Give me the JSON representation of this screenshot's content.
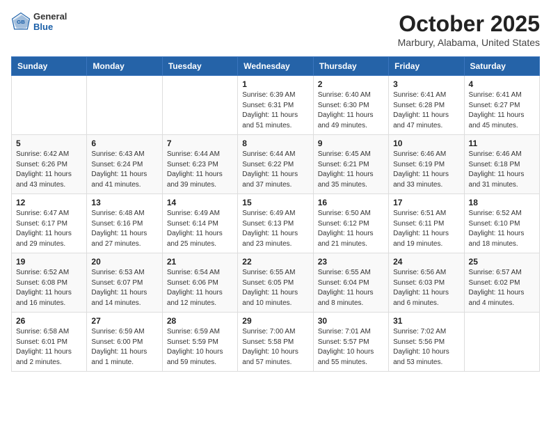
{
  "header": {
    "logo_general": "General",
    "logo_blue": "Blue",
    "month_title": "October 2025",
    "location": "Marbury, Alabama, United States"
  },
  "days_of_week": [
    "Sunday",
    "Monday",
    "Tuesday",
    "Wednesday",
    "Thursday",
    "Friday",
    "Saturday"
  ],
  "weeks": [
    [
      {
        "day": "",
        "info": ""
      },
      {
        "day": "",
        "info": ""
      },
      {
        "day": "",
        "info": ""
      },
      {
        "day": "1",
        "info": "Sunrise: 6:39 AM\nSunset: 6:31 PM\nDaylight: 11 hours\nand 51 minutes."
      },
      {
        "day": "2",
        "info": "Sunrise: 6:40 AM\nSunset: 6:30 PM\nDaylight: 11 hours\nand 49 minutes."
      },
      {
        "day": "3",
        "info": "Sunrise: 6:41 AM\nSunset: 6:28 PM\nDaylight: 11 hours\nand 47 minutes."
      },
      {
        "day": "4",
        "info": "Sunrise: 6:41 AM\nSunset: 6:27 PM\nDaylight: 11 hours\nand 45 minutes."
      }
    ],
    [
      {
        "day": "5",
        "info": "Sunrise: 6:42 AM\nSunset: 6:26 PM\nDaylight: 11 hours\nand 43 minutes."
      },
      {
        "day": "6",
        "info": "Sunrise: 6:43 AM\nSunset: 6:24 PM\nDaylight: 11 hours\nand 41 minutes."
      },
      {
        "day": "7",
        "info": "Sunrise: 6:44 AM\nSunset: 6:23 PM\nDaylight: 11 hours\nand 39 minutes."
      },
      {
        "day": "8",
        "info": "Sunrise: 6:44 AM\nSunset: 6:22 PM\nDaylight: 11 hours\nand 37 minutes."
      },
      {
        "day": "9",
        "info": "Sunrise: 6:45 AM\nSunset: 6:21 PM\nDaylight: 11 hours\nand 35 minutes."
      },
      {
        "day": "10",
        "info": "Sunrise: 6:46 AM\nSunset: 6:19 PM\nDaylight: 11 hours\nand 33 minutes."
      },
      {
        "day": "11",
        "info": "Sunrise: 6:46 AM\nSunset: 6:18 PM\nDaylight: 11 hours\nand 31 minutes."
      }
    ],
    [
      {
        "day": "12",
        "info": "Sunrise: 6:47 AM\nSunset: 6:17 PM\nDaylight: 11 hours\nand 29 minutes."
      },
      {
        "day": "13",
        "info": "Sunrise: 6:48 AM\nSunset: 6:16 PM\nDaylight: 11 hours\nand 27 minutes."
      },
      {
        "day": "14",
        "info": "Sunrise: 6:49 AM\nSunset: 6:14 PM\nDaylight: 11 hours\nand 25 minutes."
      },
      {
        "day": "15",
        "info": "Sunrise: 6:49 AM\nSunset: 6:13 PM\nDaylight: 11 hours\nand 23 minutes."
      },
      {
        "day": "16",
        "info": "Sunrise: 6:50 AM\nSunset: 6:12 PM\nDaylight: 11 hours\nand 21 minutes."
      },
      {
        "day": "17",
        "info": "Sunrise: 6:51 AM\nSunset: 6:11 PM\nDaylight: 11 hours\nand 19 minutes."
      },
      {
        "day": "18",
        "info": "Sunrise: 6:52 AM\nSunset: 6:10 PM\nDaylight: 11 hours\nand 18 minutes."
      }
    ],
    [
      {
        "day": "19",
        "info": "Sunrise: 6:52 AM\nSunset: 6:08 PM\nDaylight: 11 hours\nand 16 minutes."
      },
      {
        "day": "20",
        "info": "Sunrise: 6:53 AM\nSunset: 6:07 PM\nDaylight: 11 hours\nand 14 minutes."
      },
      {
        "day": "21",
        "info": "Sunrise: 6:54 AM\nSunset: 6:06 PM\nDaylight: 11 hours\nand 12 minutes."
      },
      {
        "day": "22",
        "info": "Sunrise: 6:55 AM\nSunset: 6:05 PM\nDaylight: 11 hours\nand 10 minutes."
      },
      {
        "day": "23",
        "info": "Sunrise: 6:55 AM\nSunset: 6:04 PM\nDaylight: 11 hours\nand 8 minutes."
      },
      {
        "day": "24",
        "info": "Sunrise: 6:56 AM\nSunset: 6:03 PM\nDaylight: 11 hours\nand 6 minutes."
      },
      {
        "day": "25",
        "info": "Sunrise: 6:57 AM\nSunset: 6:02 PM\nDaylight: 11 hours\nand 4 minutes."
      }
    ],
    [
      {
        "day": "26",
        "info": "Sunrise: 6:58 AM\nSunset: 6:01 PM\nDaylight: 11 hours\nand 2 minutes."
      },
      {
        "day": "27",
        "info": "Sunrise: 6:59 AM\nSunset: 6:00 PM\nDaylight: 11 hours\nand 1 minute."
      },
      {
        "day": "28",
        "info": "Sunrise: 6:59 AM\nSunset: 5:59 PM\nDaylight: 10 hours\nand 59 minutes."
      },
      {
        "day": "29",
        "info": "Sunrise: 7:00 AM\nSunset: 5:58 PM\nDaylight: 10 hours\nand 57 minutes."
      },
      {
        "day": "30",
        "info": "Sunrise: 7:01 AM\nSunset: 5:57 PM\nDaylight: 10 hours\nand 55 minutes."
      },
      {
        "day": "31",
        "info": "Sunrise: 7:02 AM\nSunset: 5:56 PM\nDaylight: 10 hours\nand 53 minutes."
      },
      {
        "day": "",
        "info": ""
      }
    ]
  ]
}
